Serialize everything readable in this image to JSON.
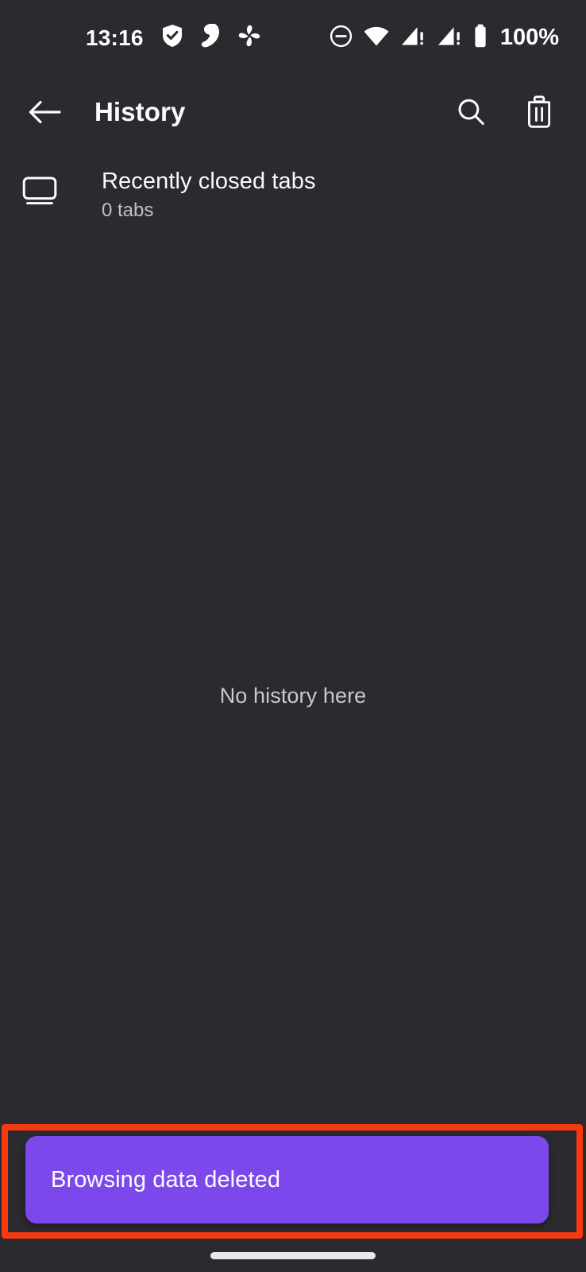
{
  "status_bar": {
    "clock": "13:16",
    "battery_percent": "100%",
    "left_icons": [
      {
        "name": "shield-check-icon",
        "label": "shield check"
      },
      {
        "name": "surfshark-vpn-icon",
        "label": "vpn"
      },
      {
        "name": "pinwheel-icon",
        "label": "pinwheel"
      }
    ],
    "right_icons": [
      {
        "name": "do-not-disturb-icon",
        "label": "do not disturb"
      },
      {
        "name": "wifi-icon",
        "label": "wifi"
      },
      {
        "name": "cellular-signal-1-icon",
        "label": "cellular 1 no service"
      },
      {
        "name": "cellular-signal-2-icon",
        "label": "cellular 2 no service"
      },
      {
        "name": "battery-icon",
        "label": "battery full"
      }
    ]
  },
  "appbar": {
    "title": "History",
    "back_label": "Back",
    "search_label": "Search history",
    "delete_label": "Delete browsing data"
  },
  "recently_closed": {
    "title": "Recently closed tabs",
    "subtitle": "0 tabs"
  },
  "empty_state": {
    "message": "No history here"
  },
  "snackbar": {
    "message": "Browsing data deleted"
  },
  "colors": {
    "background": "#2b2a2f",
    "snackbar_purple": "#7c48ec",
    "highlight_red": "#f8390f",
    "primary_text": "#fbfbfe",
    "secondary_text": "#bfbfc6"
  },
  "system_nav": {
    "home_indicator": "home-indicator"
  }
}
